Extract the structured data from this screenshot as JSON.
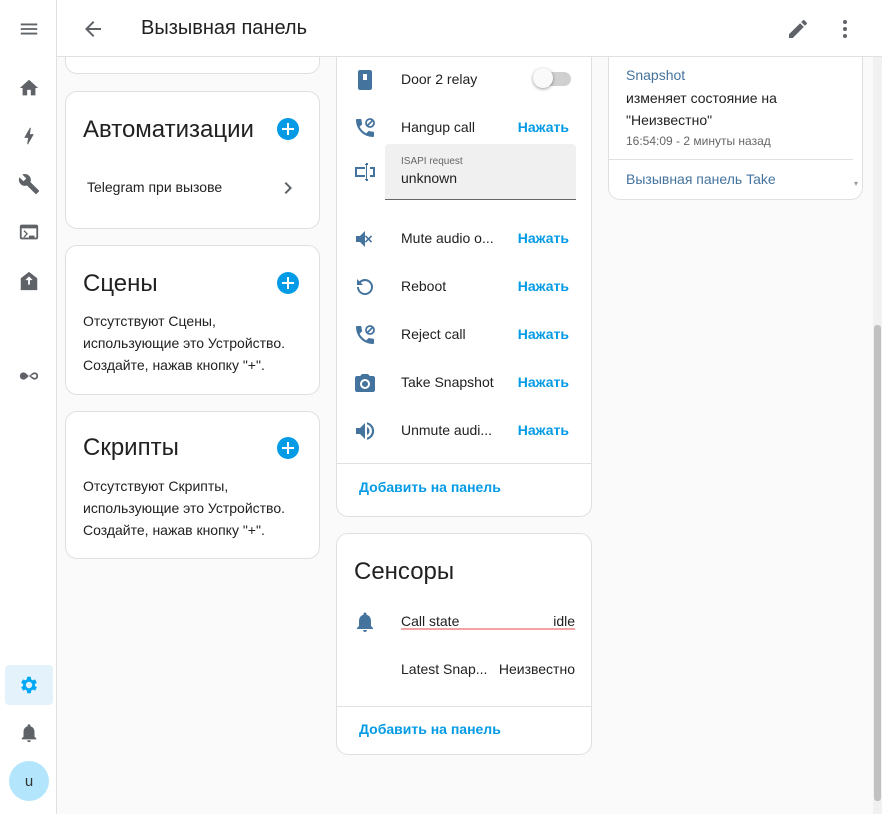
{
  "header": {
    "title": "Вызывная панель"
  },
  "sidebar": {
    "icons": [
      "menu-icon",
      "home-icon",
      "energy-icon",
      "wrench-icon",
      "terminal-icon",
      "hacs-icon",
      "automation-icon",
      "settings-icon",
      "bell-icon"
    ],
    "avatar_letter": "u",
    "active_color": "#03a9f4"
  },
  "automations": {
    "title": "Автоматизации",
    "items": [
      "Telegram при вызове"
    ]
  },
  "scenes": {
    "title": "Сцены",
    "empty_text_1": "Отсутствуют Сцены,",
    "empty_text_2": "использующие это Устройство.",
    "empty_text_3": "Создайте, нажав кнопку \"+\"."
  },
  "scripts": {
    "title": "Скрипты",
    "empty_text_1": "Отсутствуют Скрипты,",
    "empty_text_2": "использующие это Устройство.",
    "empty_text_3": "Создайте, нажав кнопку \"+\"."
  },
  "controls": {
    "rows": [
      {
        "icon": "door-relay-icon",
        "name": "Door 2 relay",
        "kind": "toggle"
      },
      {
        "icon": "phone-hangup-icon",
        "name": "Hangup call",
        "action": "Нажать"
      },
      {
        "icon": "form-textbox-icon",
        "name": "ISAPI request",
        "value": "unknown",
        "kind": "text"
      },
      {
        "icon": "volume-mute-icon",
        "name": "Mute audio o...",
        "action": "Нажать"
      },
      {
        "icon": "restart-icon",
        "name": "Reboot",
        "action": "Нажать"
      },
      {
        "icon": "phone-reject-icon",
        "name": "Reject call",
        "action": "Нажать"
      },
      {
        "icon": "camera-icon",
        "name": "Take Snapshot",
        "action": "Нажать"
      },
      {
        "icon": "volume-high-icon",
        "name": "Unmute audi...",
        "action": "Нажать"
      }
    ],
    "add_label": "Добавить на панель"
  },
  "sensors": {
    "title": "Сенсоры",
    "rows": [
      {
        "icon": "bell-icon",
        "name": "Call state",
        "value": "idle"
      },
      {
        "name": "Latest Snap...",
        "value": "Неизвестно"
      }
    ],
    "add_label": "Добавить на панель"
  },
  "logbook": {
    "entity_link": "Snapshot",
    "message_1": "изменяет состояние на",
    "message_2": "\"Неизвестно\"",
    "time": "16:54:09 - 2 минуты назад",
    "next_entry": "Вызывная панель Take"
  },
  "colors": {
    "accent": "#039be5",
    "icon": "#44739e"
  }
}
